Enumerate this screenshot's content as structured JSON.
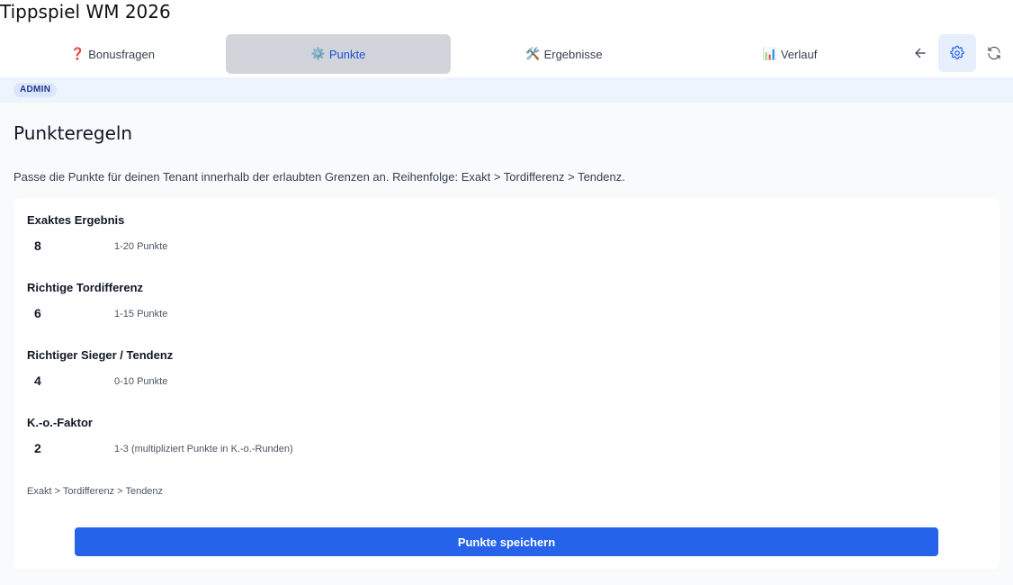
{
  "app": {
    "title": "Tippspiel WM 2026"
  },
  "tabs": [
    {
      "emoji": "❓",
      "label": "Bonusfragen",
      "active": false
    },
    {
      "emoji": "⚙️",
      "label": "Punkte",
      "active": true
    },
    {
      "emoji": "🛠️",
      "label": "Ergebnisse",
      "active": false
    },
    {
      "emoji": "📊",
      "label": "Verlauf",
      "active": false
    }
  ],
  "toolbar": {
    "back_icon": "arrow-left-icon",
    "settings_icon": "gear-icon",
    "refresh_icon": "refresh-icon",
    "accent": "#2563eb"
  },
  "admin": {
    "badge": "ADMIN"
  },
  "page": {
    "title": "Punkteregeln",
    "description": "Passe die Punkte für deinen Tenant innerhalb der erlaubten Grenzen an. Reihenfolge: Exakt > Tordifferenz > Tendenz."
  },
  "fields": [
    {
      "label": "Exaktes Ergebnis",
      "value": "8",
      "hint": "1-20 Punkte"
    },
    {
      "label": "Richtige Tordifferenz",
      "value": "6",
      "hint": "1-15 Punkte"
    },
    {
      "label": "Richtiger Sieger / Tendenz",
      "value": "4",
      "hint": "0-10 Punkte"
    },
    {
      "label": "K.-o.-Faktor",
      "value": "2",
      "hint": "1-3 (multipliziert Punkte in K.-o.-Runden)"
    }
  ],
  "footnote": "Exakt > Tordifferenz > Tendenz",
  "save_label": "Punkte speichern",
  "colors": {
    "primary": "#2563eb",
    "active_tab_bg": "#d1d5db",
    "active_tab_text": "#1d4ed8",
    "admin_strip": "#eef4fe"
  }
}
